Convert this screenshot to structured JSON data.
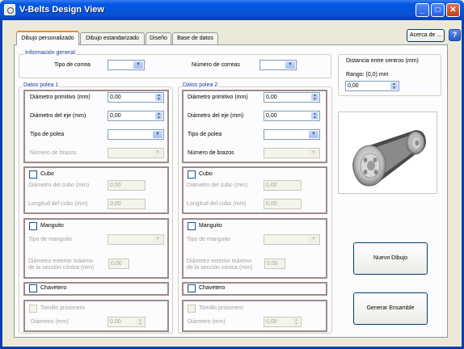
{
  "window": {
    "title": "V-Belts Design View"
  },
  "tabs": [
    "Dibujo personalizado",
    "Dibujo estandarizado",
    "Diseño",
    "Base de datos"
  ],
  "acerca_label": "Acerca de ...",
  "help_label": "?",
  "info": {
    "legend": "Información general",
    "tipo_correa_label": "Tipo de correa",
    "numero_correas_label": "Número de correas"
  },
  "polea1": {
    "legend": "Datos polea 1",
    "diam_primitivo_label": "Diámetro primitivo (mm)",
    "diam_primitivo_value": "0,00",
    "diam_eje_label": "Diámetro del eje (mm)",
    "diam_eje_value": "0,00",
    "tipo_polea_label": "Tipo de polea",
    "num_brazos_label": "Número de brazos",
    "cubo_label": "Cubo",
    "diam_cubo_label": "Diámetro del cubo (mm)",
    "diam_cubo_value": "0,00",
    "long_cubo_label": "Longitud del cubo (mm)",
    "long_cubo_value": "0,00",
    "manguito_label": "Manguito",
    "tipo_manguito_label": "Tipo de manguito",
    "diam_ext_label_1": "Diámetro exterior máximo",
    "diam_ext_label_2": "de la sección cónica (mm)",
    "diam_ext_value": "0,00",
    "chavetero_label": "Chavetero",
    "tornillo_label": "Tornillo prisionero",
    "diam_tornillo_label": "Diámetro (mm)",
    "diam_tornillo_value": "0,00"
  },
  "polea2": {
    "legend": "Datos polea 2",
    "diam_primitivo_label": "Diámetro primitivo (mm)",
    "diam_primitivo_value": "0,00",
    "diam_eje_label": "Diámetro del eje (mm)",
    "diam_eje_value": "0,00",
    "tipo_polea_label": "Tipo de polea",
    "num_brazos_label": "Número de brazos",
    "cubo_label": "Cubo",
    "diam_cubo_label": "Diámetro del cubo (mm)",
    "diam_cubo_value": "0,00",
    "long_cubo_label": "Longitud del cubo (mm)",
    "long_cubo_value": "0,00",
    "manguito_label": "Manguito",
    "tipo_manguito_label": "Tipo de manguito",
    "diam_ext_label_1": "Diámetro exterior máximo",
    "diam_ext_label_2": "de la sección cónica (mm)",
    "diam_ext_value": "0,00",
    "chavetero_label": "Chavetero",
    "tornillo_label": "Tornillo prisionero",
    "diam_tornillo_label": "Diámetro (mm)",
    "diam_tornillo_value": "0,00"
  },
  "distancia": {
    "label": "Distancia entre centros (mm)",
    "rango": "Rango: (0,0) mm",
    "value": "0,00"
  },
  "buttons": {
    "nuevo": "Nuevo Dibujo",
    "generar": "Generar Ensamble"
  },
  "colors": {
    "title_bar": "#0a52d4",
    "tab_accent": "#e68b2c",
    "legend_text": "#1c3c9c",
    "group_border": "#a08a8a"
  }
}
